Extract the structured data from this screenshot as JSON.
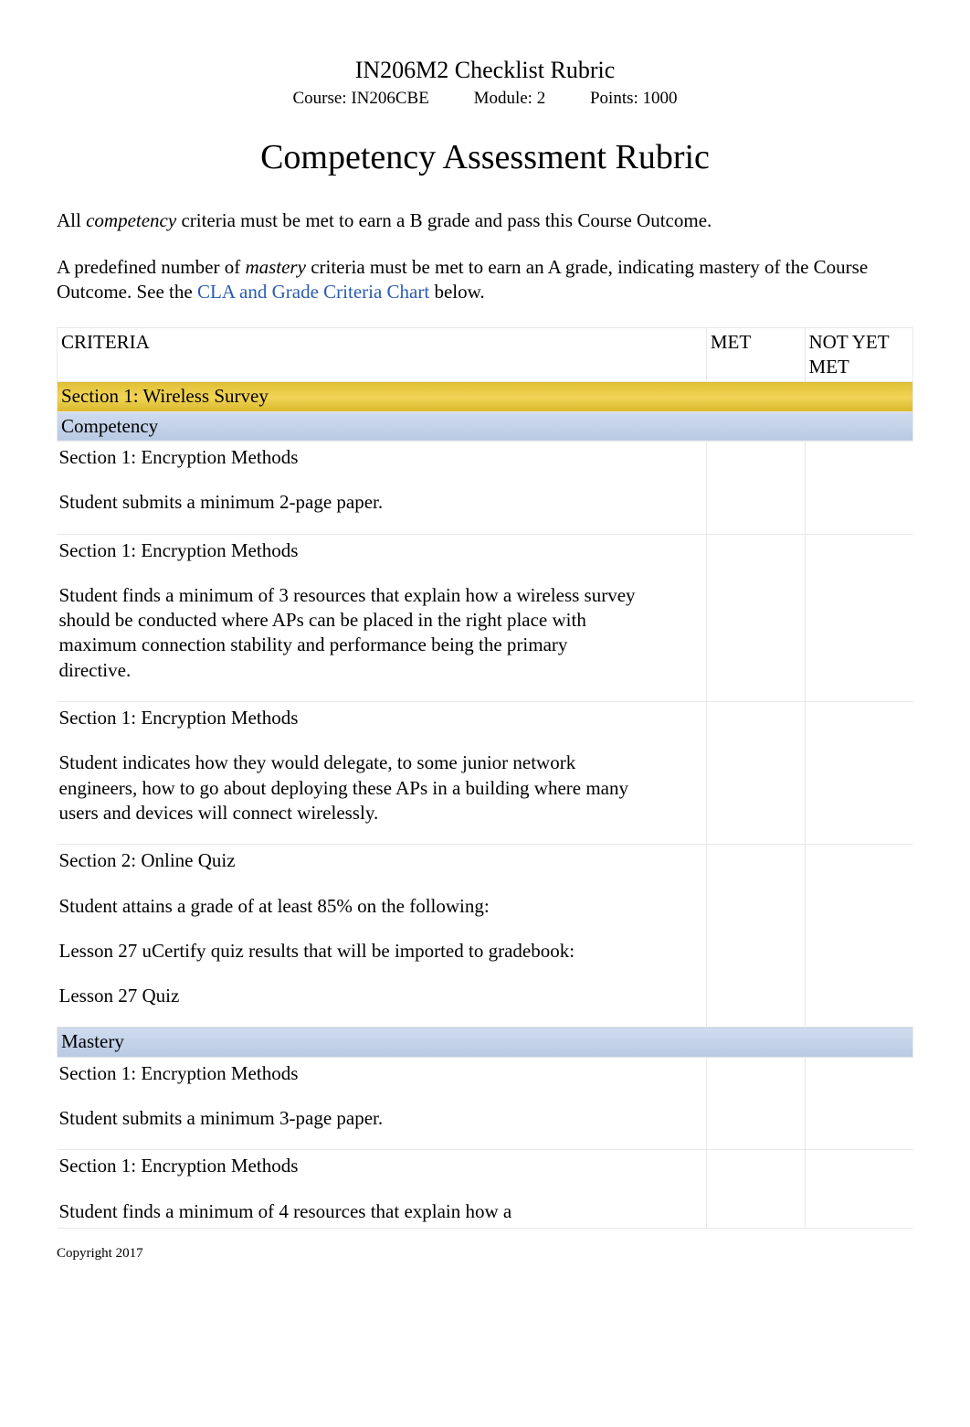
{
  "title": "IN206M2 Checklist Rubric",
  "meta": {
    "course_label": "Course: IN206CBE",
    "module_label": "Module: 2",
    "points_label": "Points: 1000"
  },
  "heading": "Competency Assessment Rubric",
  "intro1_pre": "All ",
  "intro1_em": "competency",
  "intro1_post": " criteria must be met to earn a B grade and pass this Course Outcome.",
  "intro2_pre": "A predefined number of ",
  "intro2_em": "mastery",
  "intro2_mid": " criteria must be met to earn an A grade, indicating mastery of the Course Outcome. See the ",
  "intro2_link": "CLA and Grade Criteria Chart",
  "intro2_post": " below.",
  "headers": {
    "criteria": "CRITERIA",
    "met": "MET",
    "not_yet_met": "NOT YET MET"
  },
  "section_header": "Section 1: Wireless Survey",
  "competency_label": " Competency",
  "mastery_label": " Mastery",
  "rows": {
    "c1": {
      "title": "Section 1:    Encryption Methods",
      "body": "Student submits a minimum 2-page paper."
    },
    "c2": {
      "title": "Section 1:    Encryption Methods",
      "body": "Student finds a minimum of 3 resources that explain how a wireless survey should be conducted where APs can be placed in the right place with maximum connection stability and performance being the primary directive."
    },
    "c3": {
      "title": "Section 1:    Encryption Methods",
      "body": "Student indicates how they would delegate, to some junior network engineers, how to go about deploying these APs in a building where many users and devices will connect wirelessly."
    },
    "c4": {
      "title": "Section 2: Online Quiz",
      "body_l1": "Student attains a grade of at least 85% on the following:",
      "body_l2": "Lesson 27 uCertify quiz results that will be imported to gradebook:",
      "body_l3": "Lesson 27 Quiz"
    },
    "m1": {
      "title": "Section 1:    Encryption Methods",
      "body": "Student submits a minimum 3-page paper."
    },
    "m2": {
      "title": "Section 1:    Encryption Methods",
      "body": "Student finds a minimum of 4 resources that explain how a"
    }
  },
  "footer": "Copyright 2017"
}
